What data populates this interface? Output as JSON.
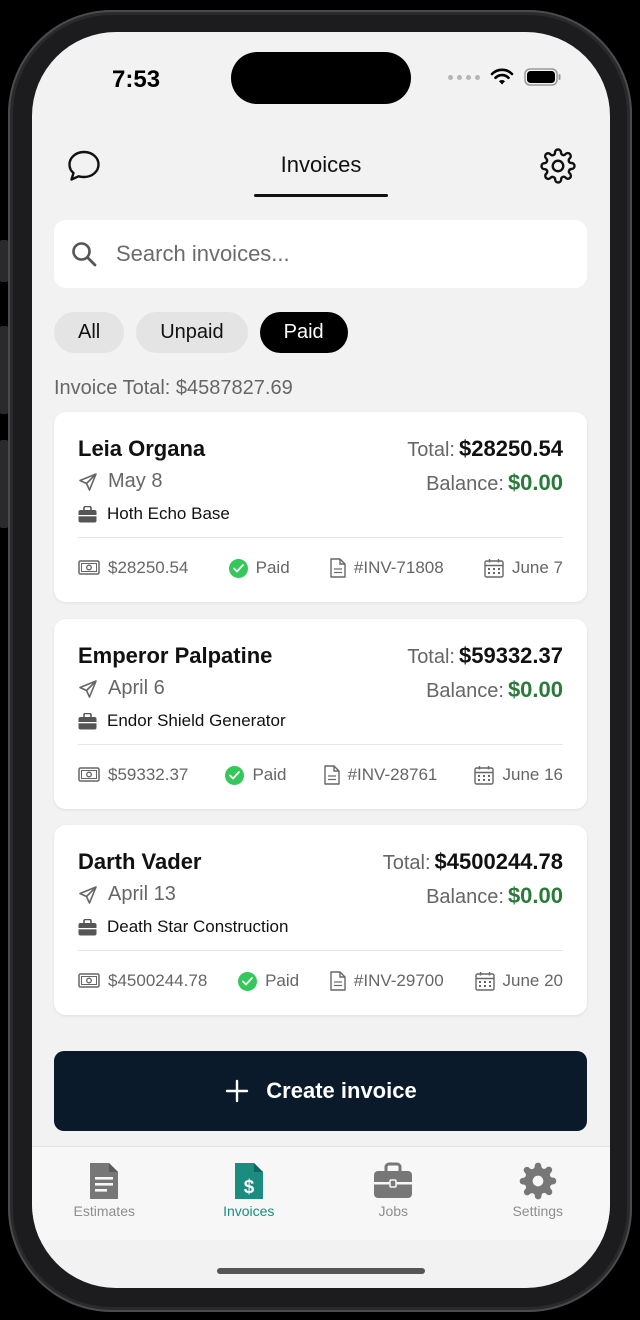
{
  "status_bar": {
    "time": "7:53"
  },
  "header": {
    "title": "Invoices"
  },
  "search": {
    "placeholder": "Search invoices..."
  },
  "filters": [
    {
      "label": "All",
      "active": false
    },
    {
      "label": "Unpaid",
      "active": false
    },
    {
      "label": "Paid",
      "active": true
    }
  ],
  "summary": {
    "invoice_total": "Invoice Total: $4587827.69"
  },
  "labels": {
    "total": "Total:",
    "balance": "Balance:"
  },
  "invoices": [
    {
      "name": "Leia Organa",
      "sent_date": "May 8",
      "client": "Hoth Echo Base",
      "total": "$28250.54",
      "balance": "$0.00",
      "amount": "$28250.54",
      "status": "Paid",
      "number": "#INV-71808",
      "due": "June 7"
    },
    {
      "name": "Emperor Palpatine",
      "sent_date": "April 6",
      "client": "Endor Shield Generator",
      "total": "$59332.37",
      "balance": "$0.00",
      "amount": "$59332.37",
      "status": "Paid",
      "number": "#INV-28761",
      "due": "June 16"
    },
    {
      "name": "Darth Vader",
      "sent_date": "April 13",
      "client": "Death Star Construction",
      "total": "$4500244.78",
      "balance": "$0.00",
      "amount": "$4500244.78",
      "status": "Paid",
      "number": "#INV-29700",
      "due": "June 20"
    }
  ],
  "create_button": {
    "label": "Create invoice"
  },
  "tabs": [
    {
      "label": "Estimates",
      "icon": "estimate-document-icon",
      "active": false
    },
    {
      "label": "Invoices",
      "icon": "invoice-dollar-icon",
      "active": true
    },
    {
      "label": "Jobs",
      "icon": "briefcase-icon",
      "active": false
    },
    {
      "label": "Settings",
      "icon": "gear-icon",
      "active": false
    }
  ],
  "colors": {
    "accent": "#1a8c80",
    "balance_green": "#2a7a3a",
    "primary_button": "#0b1a2a",
    "paid_check": "#34c759"
  }
}
